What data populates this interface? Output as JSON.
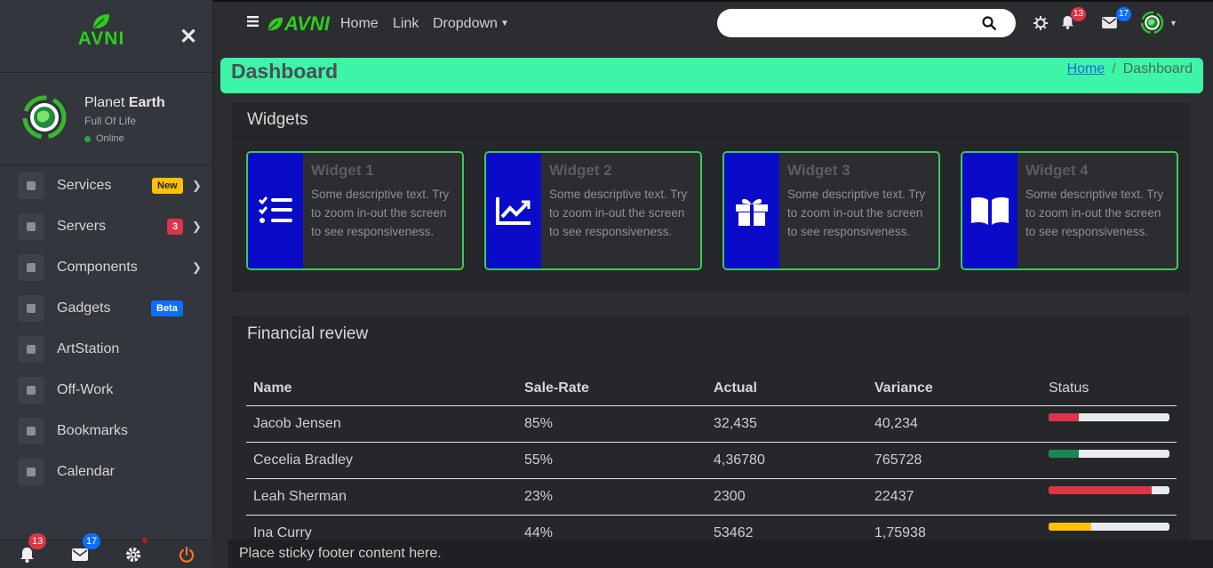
{
  "sidebar": {
    "brand": "AVNI",
    "profile": {
      "first": "Planet",
      "last": "Earth",
      "tagline": "Full Of Life",
      "status": "Online"
    },
    "items": [
      {
        "label": "Services",
        "badge": "New",
        "badge_bg": "#ffc107",
        "badge_fg": "#222",
        "chevron": true
      },
      {
        "label": "Servers",
        "badge": "3",
        "badge_bg": "#dc3545",
        "badge_fg": "#fff",
        "chevron": true
      },
      {
        "label": "Components",
        "badge": "",
        "chevron": true
      },
      {
        "label": "Gadgets",
        "badge": "Beta",
        "badge_bg": "#0d6efd",
        "badge_fg": "#fff",
        "chevron": false
      },
      {
        "label": "ArtStation",
        "badge": "",
        "chevron": false
      },
      {
        "label": "Off-Work",
        "badge": "",
        "chevron": false
      },
      {
        "label": "Bookmarks",
        "badge": "",
        "chevron": false
      },
      {
        "label": "Calendar",
        "badge": "",
        "chevron": false
      }
    ],
    "footer": {
      "notifications": "13",
      "messages": "17"
    }
  },
  "topbar": {
    "brand": "AVNI",
    "links": [
      "Home",
      "Link",
      "Dropdown"
    ],
    "search_placeholder": "",
    "notifications": "13",
    "messages": "17"
  },
  "page": {
    "title": "Dashboard",
    "breadcrumb": {
      "home": "Home",
      "current": "Dashboard"
    }
  },
  "widgets": {
    "heading": "Widgets",
    "items": [
      {
        "title": "Widget 1",
        "desc": "Some descriptive text. Try to zoom in-out the screen to see responsiveness.",
        "icon": "checklist-icon"
      },
      {
        "title": "Widget 2",
        "desc": "Some descriptive text. Try to zoom in-out the screen to see responsiveness.",
        "icon": "chart-line-icon"
      },
      {
        "title": "Widget 3",
        "desc": "Some descriptive text. Try to zoom in-out the screen to see responsiveness.",
        "icon": "gift-icon"
      },
      {
        "title": "Widget 4",
        "desc": "Some descriptive text. Try to zoom in-out the screen to see responsiveness.",
        "icon": "book-icon"
      }
    ]
  },
  "financial": {
    "heading": "Financial review",
    "columns": [
      "Name",
      "Sale-Rate",
      "Actual",
      "Variance",
      "Status"
    ],
    "rows": [
      {
        "name": "Jacob Jensen",
        "rate": "85%",
        "actual": "32,435",
        "variance": "40,234",
        "progress": 25,
        "color": "#dc3545"
      },
      {
        "name": "Cecelia Bradley",
        "rate": "55%",
        "actual": "4,36780",
        "variance": "765728",
        "progress": 25,
        "color": "#198754"
      },
      {
        "name": "Leah Sherman",
        "rate": "23%",
        "actual": "2300",
        "variance": "22437",
        "progress": 85,
        "color": "#dc3545"
      },
      {
        "name": "Ina Curry",
        "rate": "44%",
        "actual": "53462",
        "variance": "1,75938",
        "progress": 35,
        "color": "#ffc107"
      }
    ]
  },
  "footer": {
    "text": "Place sticky footer content here."
  }
}
